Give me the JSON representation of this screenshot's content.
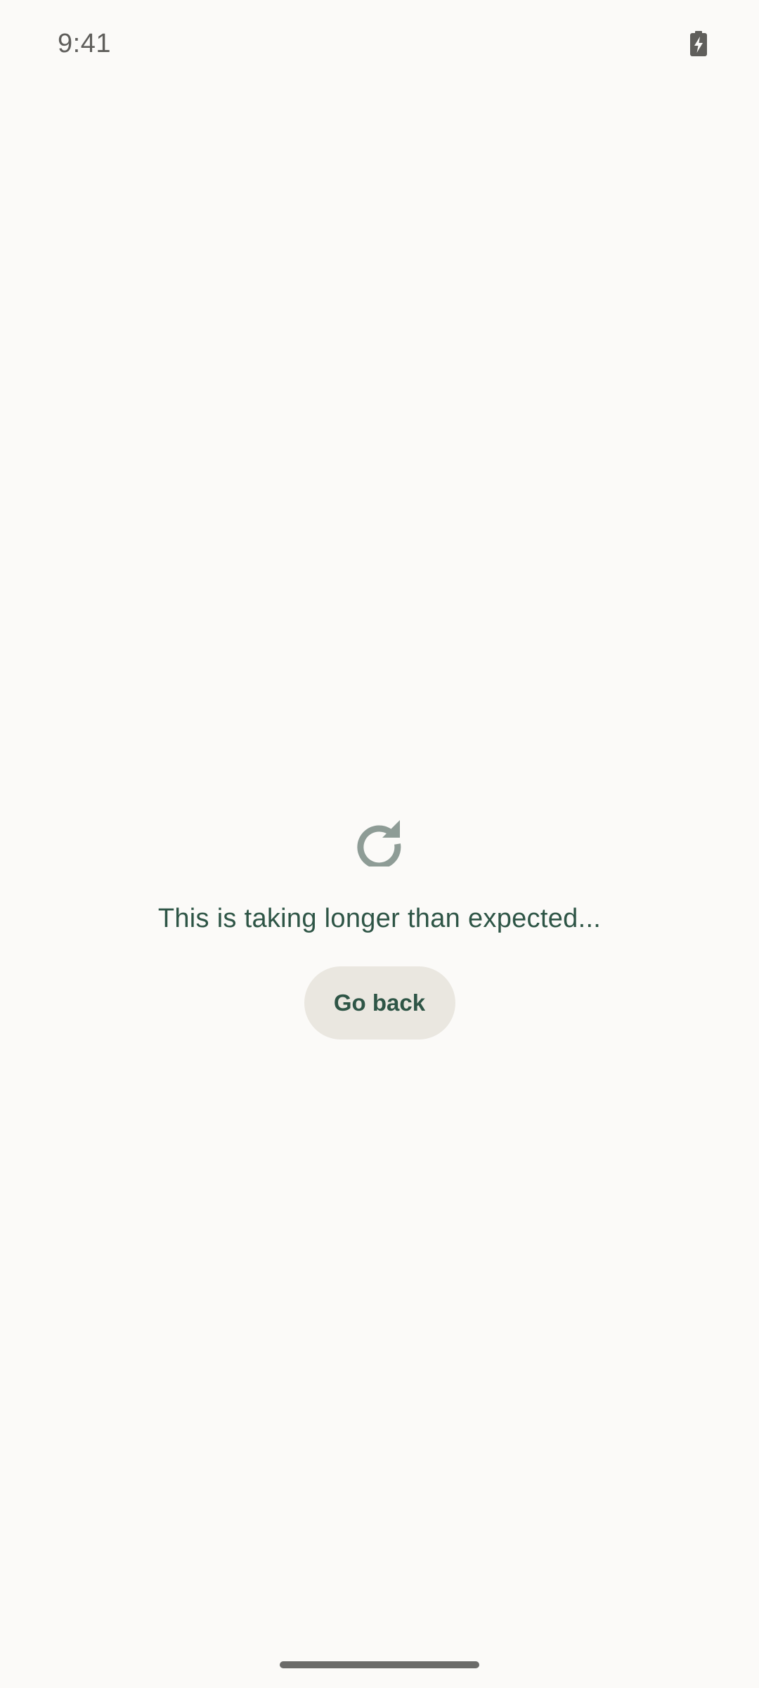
{
  "status_bar": {
    "time": "9:41",
    "battery_icon": "battery-charging-icon"
  },
  "main": {
    "icon": "refresh-icon",
    "message": "This is taking longer than expected...",
    "go_back_label": "Go back"
  },
  "colors": {
    "background": "#FBFAF8",
    "text_primary": "#2E5546",
    "icon": "#8E9C96",
    "button_background": "#EAE7E0",
    "status_text": "#5F5E5B"
  }
}
